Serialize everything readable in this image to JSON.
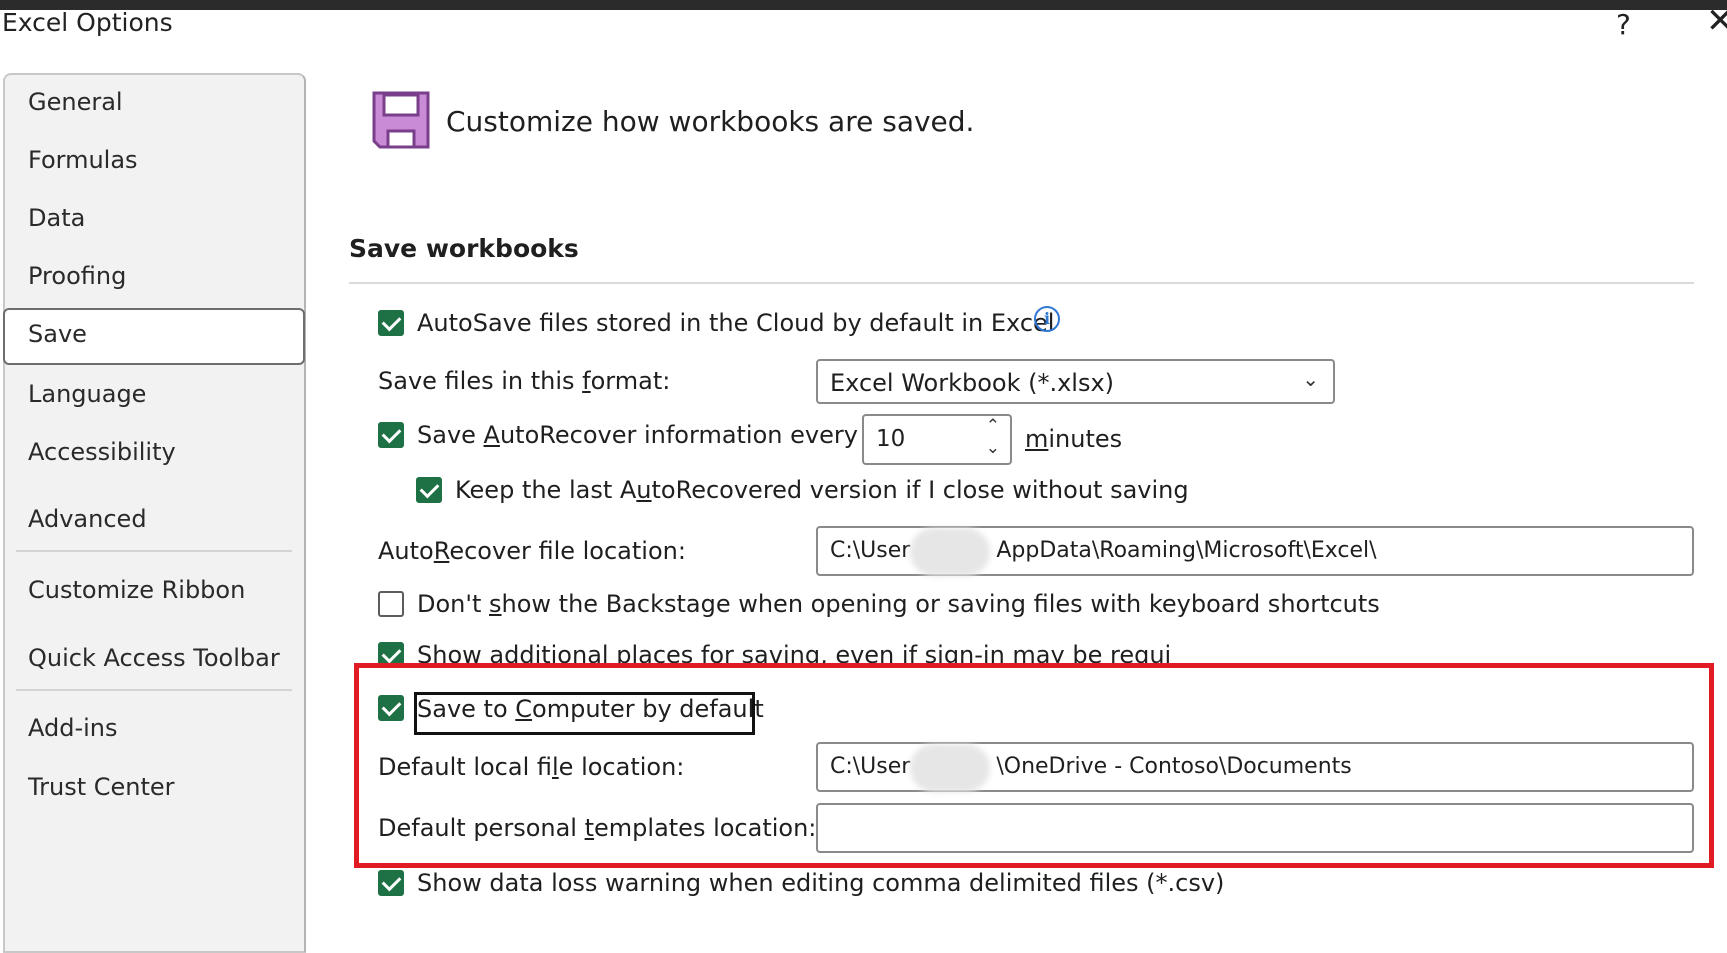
{
  "window": {
    "title": "Excel Options",
    "help": "?",
    "close": "✕"
  },
  "sidebar": {
    "items": [
      {
        "label": "General"
      },
      {
        "label": "Formulas"
      },
      {
        "label": "Data"
      },
      {
        "label": "Proofing"
      },
      {
        "label": "Save",
        "selected": true
      },
      {
        "label": "Language"
      },
      {
        "label": "Accessibility"
      },
      {
        "label": "Advanced"
      },
      {
        "label": "Customize Ribbon"
      },
      {
        "label": "Quick Access Toolbar"
      },
      {
        "label": "Add-ins"
      },
      {
        "label": "Trust Center"
      }
    ]
  },
  "main": {
    "heading": "Customize how workbooks are saved.",
    "section_title": "Save workbooks",
    "autosave": {
      "label": "AutoSave files stored in the Cloud by default in Excel",
      "checked": true,
      "info_icon": "info-icon"
    },
    "format": {
      "label_pre": "Save files in this ",
      "label_u": "f",
      "label_post": "ormat:",
      "value": "Excel Workbook (*.xlsx)"
    },
    "autorecover": {
      "label_pre": "Save ",
      "label_u": "A",
      "label_post": "utoRecover information every",
      "checked": true,
      "minutes_value": "10",
      "minutes_u": "m",
      "minutes_post": "inutes"
    },
    "keep_last": {
      "label_pre": "Keep the last A",
      "label_u": "u",
      "label_post": "toRecovered version if I close without saving",
      "checked": true
    },
    "autorecover_location": {
      "label_pre": "Auto",
      "label_u": "R",
      "label_post": "ecover file location:",
      "value_pre": "C:\\User",
      "value_post": "AppData\\Roaming\\Microsoft\\Excel\\"
    },
    "backstage": {
      "label_pre": "Don't ",
      "label_u": "s",
      "label_post": "how the Backstage when opening or saving files with keyboard shortcuts",
      "checked": false
    },
    "additional_places": {
      "label": "Show additional places for saving, even if sign-in may be required.",
      "checked": true
    },
    "save_to_computer": {
      "label_pre": "Save to ",
      "label_u": "C",
      "label_post": "omputer by default",
      "checked": true
    },
    "default_local": {
      "label_pre": "Default local fi",
      "label_u": "l",
      "label_post": "e location:",
      "value_pre": "C:\\User",
      "value_post": "\\OneDrive - Contoso\\Documents"
    },
    "templates": {
      "label_pre": "Default personal ",
      "label_u": "t",
      "label_post": "emplates location:",
      "value": ""
    },
    "csv_warning": {
      "label": "Show data loss warning when editing comma delimited files (*.csv)",
      "checked": true
    }
  },
  "colors": {
    "accent_green": "#1e7145",
    "highlight_red": "#e01b24",
    "save_icon_purple": "#c98ad6"
  }
}
